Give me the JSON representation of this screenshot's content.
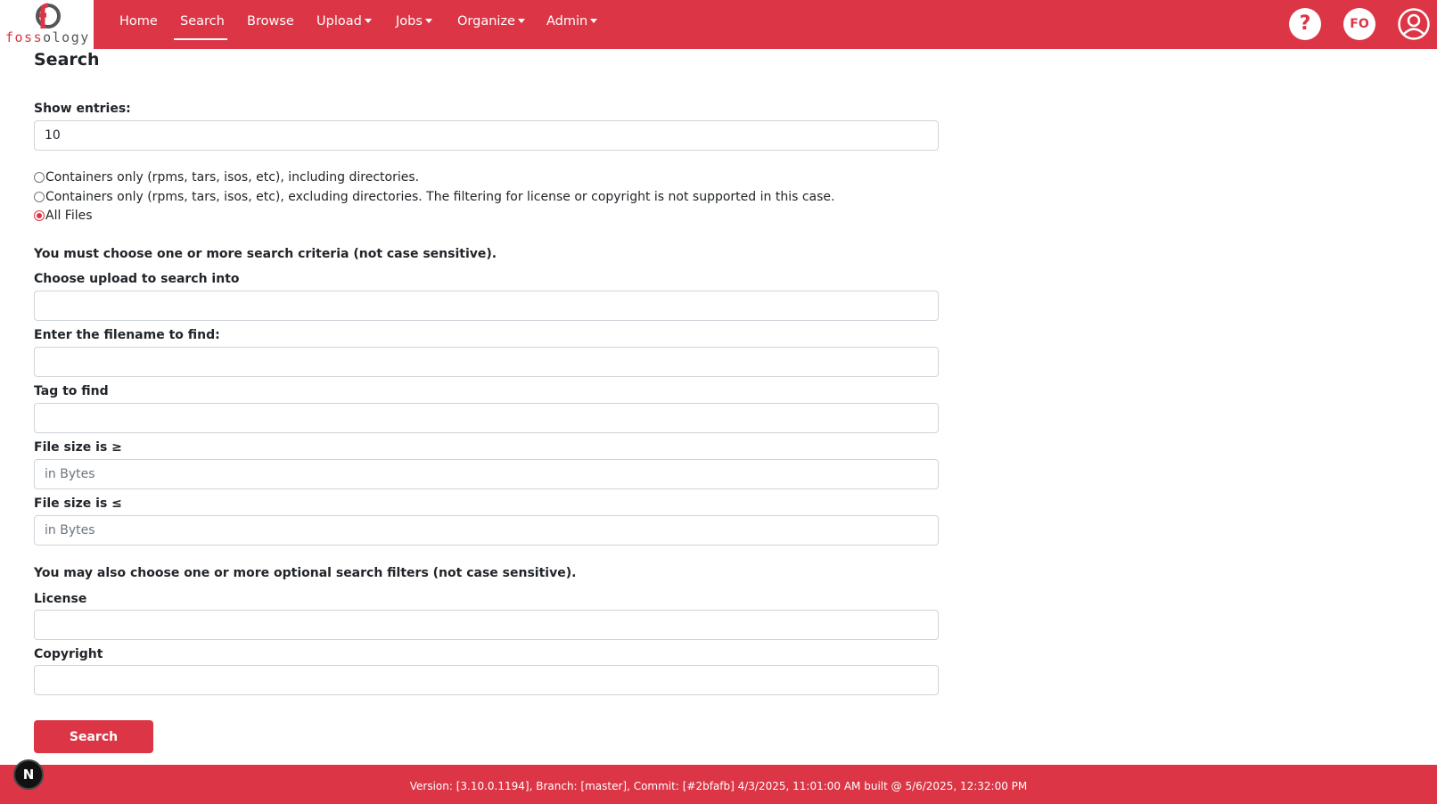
{
  "brand": {
    "logo_text_red": "foss",
    "logo_text_gray": "ology"
  },
  "nav": {
    "items": [
      {
        "label": "Home",
        "dropdown": false
      },
      {
        "label": "Search",
        "dropdown": false,
        "active": true
      },
      {
        "label": "Browse",
        "dropdown": false
      },
      {
        "label": "Upload",
        "dropdown": true
      },
      {
        "label": "Jobs",
        "dropdown": true
      },
      {
        "label": "Organize",
        "dropdown": true
      },
      {
        "label": "Admin",
        "dropdown": true
      }
    ],
    "help_icon": "question-icon",
    "user_initials": "FO",
    "profile_icon": "user-circle-icon"
  },
  "page": {
    "title": "Search"
  },
  "form": {
    "show_entries_label": "Show entries:",
    "show_entries_value": "10",
    "radios": [
      {
        "label": "Containers only (rpms, tars, isos, etc), including directories.",
        "checked": false
      },
      {
        "label": "Containers only (rpms, tars, isos, etc), excluding directories. The filtering for license or copyright is not supported in this case.",
        "checked": false
      },
      {
        "label": "All Files",
        "checked": true
      }
    ],
    "criteria_note": "You must choose one or more search criteria (not case sensitive).",
    "upload_label": "Choose upload to search into",
    "upload_value": "",
    "filename_label": "Enter the filename to find:",
    "filename_value": "",
    "tag_label": "Tag to find",
    "tag_value": "",
    "size_min_label": "File size is ≥",
    "size_min_placeholder": "in Bytes",
    "size_max_label": "File size is ≤",
    "size_max_placeholder": "in Bytes",
    "filters_note": "You may also choose one or more optional search filters (not case sensitive).",
    "license_label": "License",
    "license_value": "",
    "copyright_label": "Copyright",
    "copyright_value": "",
    "submit_label": "Search"
  },
  "footer": {
    "text": "Version: [3.10.0.1194], Branch: [master], Commit: [#2bfafb] 4/3/2025, 11:01:00 AM built @ 5/6/2025, 12:32:00 PM"
  },
  "dev_badge": "N",
  "colors": {
    "accent": "#dc3545",
    "text": "#212529",
    "border": "#ced4da"
  }
}
